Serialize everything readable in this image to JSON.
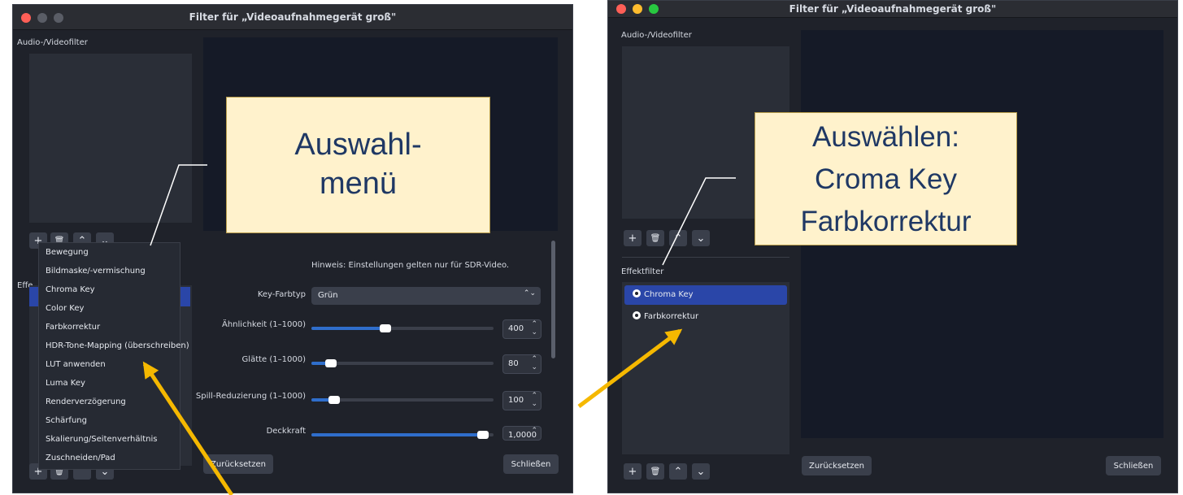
{
  "left_window": {
    "title": "Filter für „Videoaufnahmegerät groß\"",
    "audio_video_label": "Audio-/Videofilter",
    "effekt_label_partial": "Effe",
    "hint": "Hinweis: Einstellungen gelten nur für SDR-Video.",
    "key_color_label": "Key-Farbtyp",
    "key_color_value": "Grün",
    "properties": [
      {
        "label": "Ähnlichkeit (1–1000)",
        "value": "400",
        "level": 0.4
      },
      {
        "label": "Glätte (1–1000)",
        "value": "80",
        "level": 0.08
      },
      {
        "label": "Spill-Reduzierung (1–1000)",
        "value": "100",
        "level": 0.1
      },
      {
        "label": "Deckkraft",
        "value": "1,0000",
        "level": 1.0
      }
    ],
    "reset_button": "Zurücksetzen",
    "close_button": "Schließen",
    "menu_items": [
      "Bewegung",
      "Bildmaske/-vermischung",
      "Chroma Key",
      "Color Key",
      "Farbkorrektur",
      "HDR-Tone-Mapping (überschreiben)",
      "LUT anwenden",
      "Luma Key",
      "Renderverzögerung",
      "Schärfung",
      "Skalierung/Seitenverhältnis",
      "Zuschneiden/Pad"
    ],
    "callout_line1": "Auswahl-",
    "callout_line2": "menü"
  },
  "right_window": {
    "title": "Filter für „Videoaufnahmegerät groß\"",
    "audio_video_label": "Audio-/Videofilter",
    "effekt_label": "Effektfilter",
    "filters": [
      "Chroma Key",
      "Farbkorrektur"
    ],
    "reset_button": "Zurücksetzen",
    "close_button": "Schließen",
    "callout_line1": "Auswählen:",
    "callout_line2": "Croma Key",
    "callout_line3": "Farbkorrektur"
  },
  "icons": {
    "add": "+",
    "remove": "🗑",
    "up": "⌃",
    "down": "⌄",
    "updown": "⌃⌄"
  },
  "colors": {
    "accent": "#2f6ecb",
    "selected": "#2a46a8",
    "callout_bg": "#fff2cc",
    "callout_text": "#1f3864",
    "arrow": "#f5b800"
  }
}
